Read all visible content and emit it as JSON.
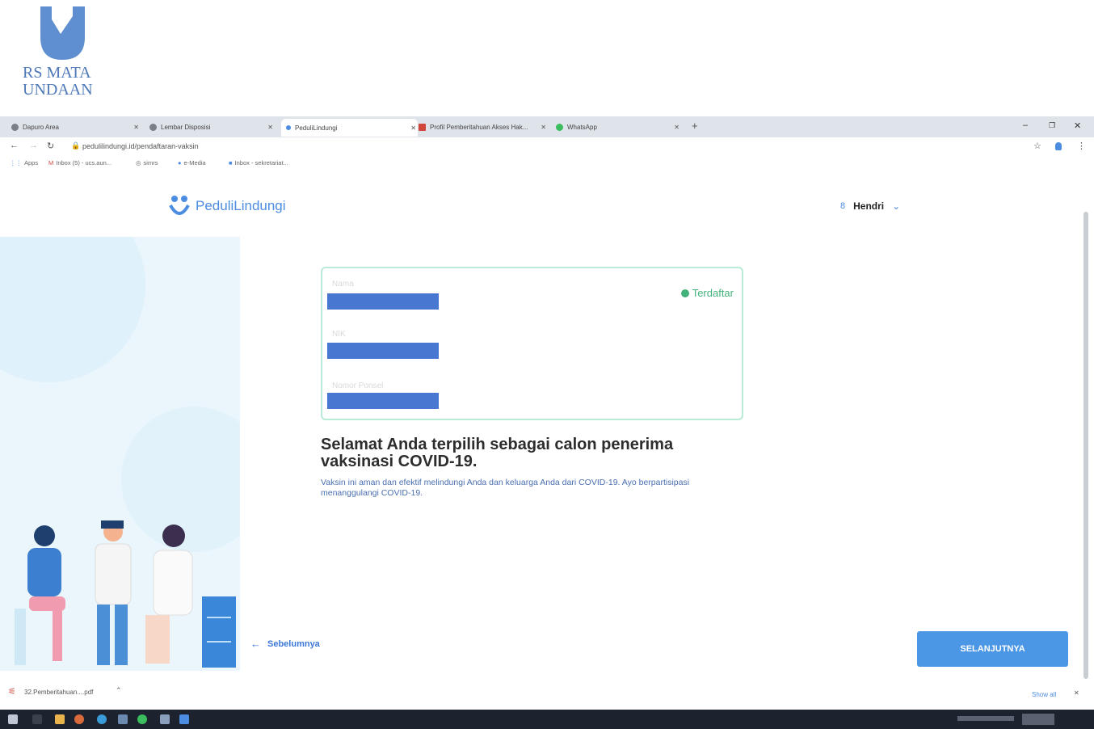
{
  "logo": {
    "line1": "RS MATA",
    "line2": "UNDAAN",
    "color": "#4f79b8"
  },
  "browser": {
    "tabs": [
      {
        "label": "Dapuro Area",
        "icon": "globe-icon"
      },
      {
        "label": "Lembar Disposisi",
        "icon": "globe-icon"
      },
      {
        "label": "PeduliLindungi",
        "icon": "pedulilindungi-icon"
      },
      {
        "label": "Profil Pemberitahuan Akses Hak...",
        "icon": "mail-icon"
      },
      {
        "label": "WhatsApp",
        "icon": "whatsapp-icon"
      }
    ],
    "url": "pedulilindungi.id/pendaftaran-vaksin",
    "bookmarks": [
      "Apps",
      "Inbox (5) - ucs.aun...",
      "simrs",
      "e-Media",
      "Inbox - sekretariat..."
    ]
  },
  "page": {
    "brand": "PeduliLindungi",
    "user": "Hendri",
    "card": {
      "name_label": "Nama",
      "nik_label": "NIK",
      "phone_label": "Nomor Ponsel",
      "status": "Terdaftar"
    },
    "heading": "Selamat Anda terpilih sebagai calon penerima vaksinasi COVID-19.",
    "subtext": "Vaksin ini aman dan efektif melindungi Anda dan keluarga Anda dari COVID-19. Ayo berpartisipasi menanggulangi COVID-19.",
    "prev_label": "Sebelumnya",
    "next_label": "SELANJUTNYA"
  },
  "downloads": {
    "file": "32.Pemberitahuan....pdf",
    "show_all": "Show all"
  },
  "colors": {
    "accent": "#4b97e6",
    "success": "#44b27b",
    "redaction": "#4777d1"
  }
}
